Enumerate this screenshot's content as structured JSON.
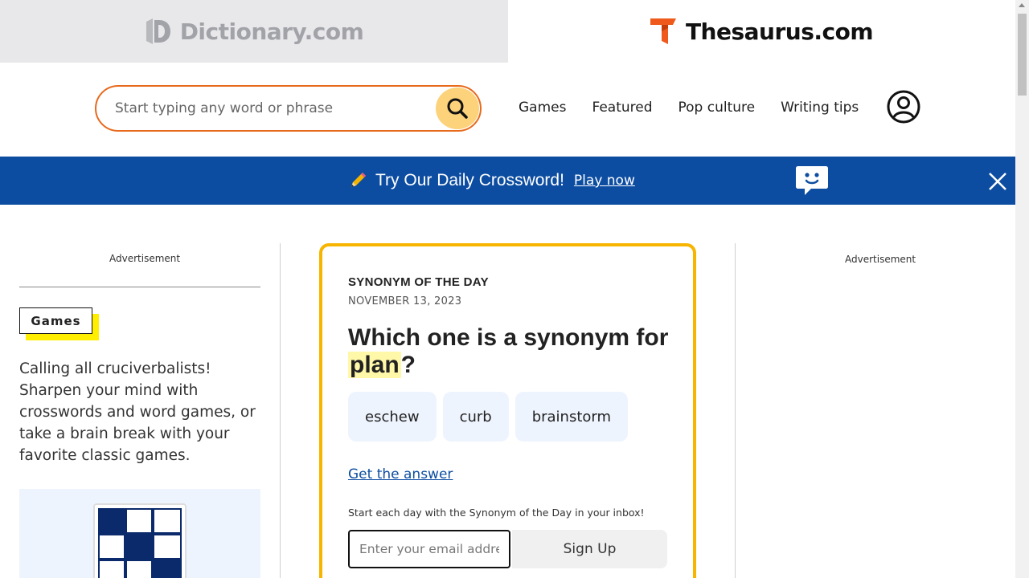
{
  "site_tabs": {
    "dictionary": {
      "label": "Dictionary.com",
      "icon": "dictionary-logo-icon"
    },
    "thesaurus": {
      "label": "Thesaurus.com",
      "icon": "thesaurus-logo-icon"
    }
  },
  "header": {
    "search_placeholder": "Start typing any word or phrase",
    "nav": [
      "Games",
      "Featured",
      "Pop culture",
      "Writing tips"
    ]
  },
  "banner": {
    "text": "Try Our Daily Crossword!",
    "link": "Play now",
    "icon": "pencil-icon",
    "background": "#0d4da1"
  },
  "left": {
    "ad_label": "Advertisement",
    "tag": "Games",
    "description": "Calling all cruciverbalists! Sharpen your mind with crosswords and word games, or take a brain break with your favorite classic games."
  },
  "right": {
    "ad_label": "Advertisement"
  },
  "synonym": {
    "eyebrow": "SYNONYM OF THE DAY",
    "date": "NOVEMBER 13, 2023",
    "question_pre": "Which one is a synonym for ",
    "word": "plan",
    "question_post": "?",
    "choices": [
      "eschew",
      "curb",
      "brainstorm"
    ],
    "answer_link": "Get the answer",
    "promo": "Start each day with the Synonym of the Day in your inbox!",
    "email_placeholder": "Enter your email address",
    "signup_label": "Sign Up"
  },
  "colors": {
    "accent_orange": "#e76a1d",
    "search_button": "#fcd27a",
    "card_border": "#f7b500",
    "highlight": "#fff8a8",
    "games_highlight": "#ffee00",
    "link": "#0d4da1"
  }
}
